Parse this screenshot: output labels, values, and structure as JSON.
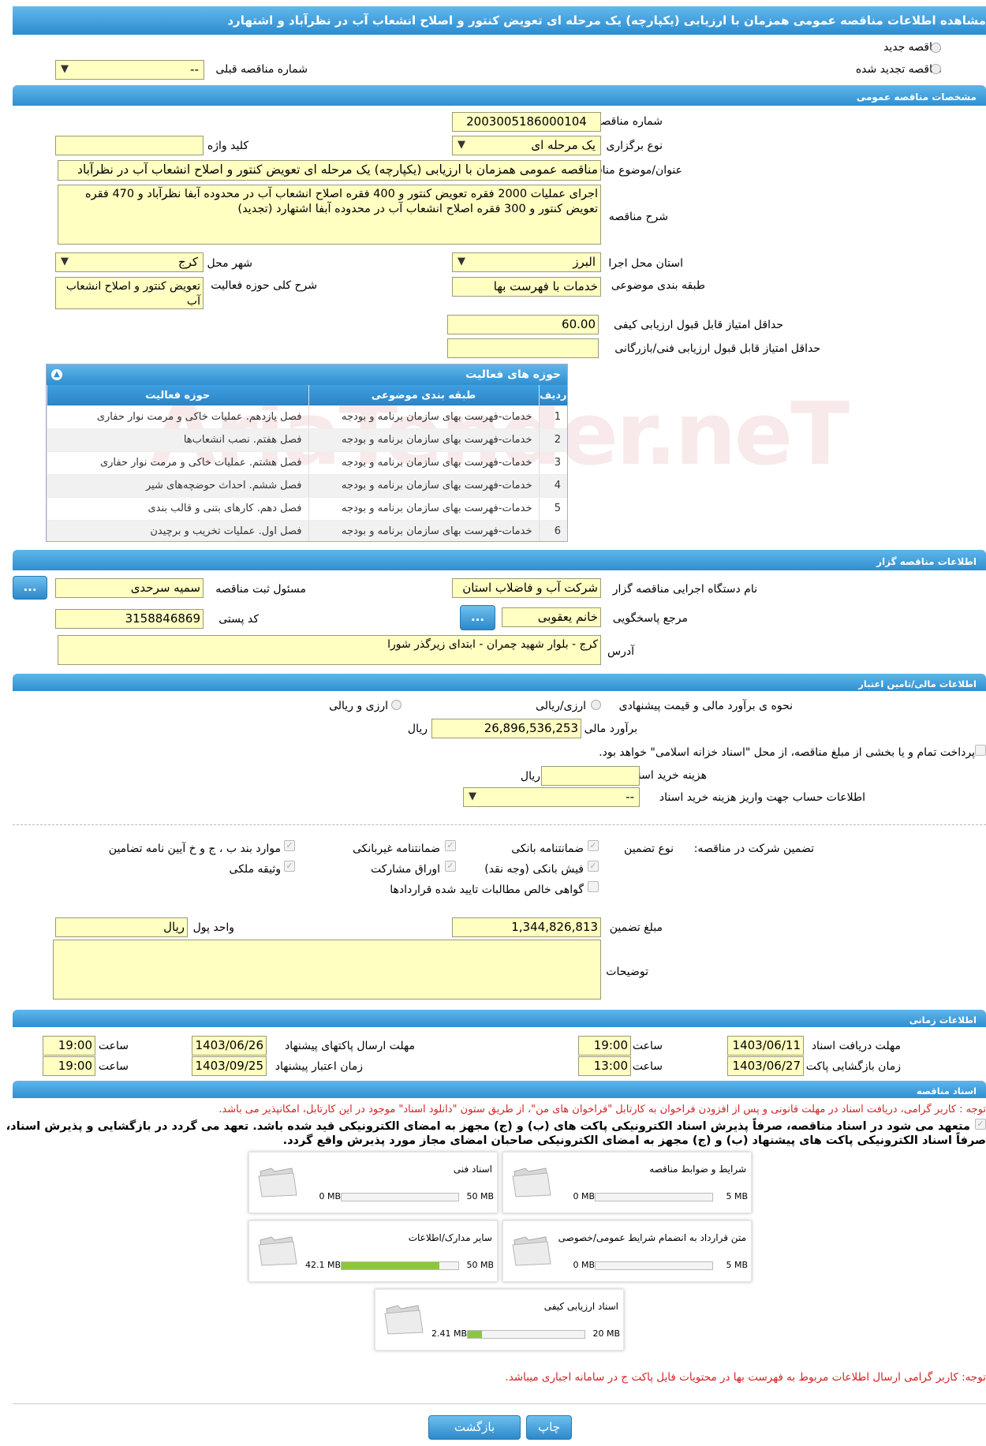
{
  "title": "مشاهده اطلاعات مناقصه عمومی همزمان با ارزیابی (یکپارچه) یک مرحله ای تعویض کنتور و اصلاح انشعاب آب در نظرآباد و اشتهارد",
  "top": {
    "new_tender": "مناقصه جدید",
    "renewed_tender": "مناقصه تجدید شده",
    "prev_tender_label": "شماره مناقصه قبلی",
    "prev_tender_value": "--"
  },
  "general": {
    "section": "مشخصات مناقصه عمومی",
    "tender_no_label": "شماره مناقصه",
    "tender_no": "2003005186000104",
    "type_label": "نوع برگزاری",
    "type_value": "یک مرحله ای",
    "keyword_label": "کلید واژه",
    "keyword": "",
    "subject_label": "عنوان/موضوع مناقصه",
    "subject": "مناقصه عمومی همزمان با ارزیابی (یکپارچه) یک مرحله ای تعویض کنتور و اصلاح انشعاب آب در نظرآباد",
    "desc_label": "شرح مناقصه",
    "desc": "اجرای عملیات 2000 فقره تعویض کنتور و 400 فقره اصلاح انشعاب آب در محدوده آبفا نظرآباد و 470 فقره تعویض کنتور و 300 فقره اصلاح انشعاب آب در محدوده آبفا اشتهارد (تجدید)",
    "province_label": "استان محل اجرا",
    "province": "البرز",
    "city_label": "شهر محل اجرا",
    "city": "کرج",
    "category_label": "طبقه بندی موضوعی",
    "category": "خدمات با فهرست بها",
    "activity_desc_label": "شرح کلی حوزه فعالیت",
    "activity_desc": "تعویض کنتور و اصلاح انشعاب آب",
    "min_quality_label": "حداقل امتیاز قابل قبول ارزیابی کیفی",
    "min_quality": "60.00",
    "min_tech_label": "حداقل امتیاز قابل قبول ارزیابی فنی/بازرگانی",
    "min_tech": ""
  },
  "activities": {
    "title": "حوزه های فعالیت",
    "headers": [
      "ردیف",
      "طبقه بندی موضوعی",
      "حوزه فعالیت"
    ],
    "rows": [
      {
        "no": "1",
        "cat": "خدمات-فهرست بهای سازمان برنامه و بودجه",
        "area": "فصل یازدهم. عملیات خاکی و مرمت نوار حفاری"
      },
      {
        "no": "2",
        "cat": "خدمات-فهرست بهای سازمان برنامه و بودجه",
        "area": "فصل هفتم. نصب انشعاب‌ها"
      },
      {
        "no": "3",
        "cat": "خدمات-فهرست بهای سازمان برنامه و بودجه",
        "area": "فصل هشتم. عملیات خاکی و مرمت نوار حفاری"
      },
      {
        "no": "4",
        "cat": "خدمات-فهرست بهای سازمان برنامه و بودجه",
        "area": "فصل ششم. احداث حوضچه‌های شیر"
      },
      {
        "no": "5",
        "cat": "خدمات-فهرست بهای سازمان برنامه و بودجه",
        "area": "فصل دهم. کارهای بتنی و قالب بندی"
      },
      {
        "no": "6",
        "cat": "خدمات-فهرست بهای سازمان برنامه و بودجه",
        "area": "فصل اول. عملیات تخریب و برچیدن"
      }
    ]
  },
  "organizer": {
    "section": "اطلاعات مناقصه گزار",
    "org_label": "نام دستگاه اجرایی مناقصه گزار",
    "org": "شرکت آب و فاضلاب استان",
    "registrar_label": "مسئول ثبت مناقصه",
    "registrar": "سمیه سرحدی",
    "ref_label": "مرجع پاسخگویی",
    "ref": "خانم یعقوبی",
    "postal_label": "کد پستی",
    "postal": "3158846869",
    "address_label": "آدرس",
    "address": "کرج - بلوار شهید چمران - ابتدای زیرگذر شورا",
    "more_btn": "..."
  },
  "financial": {
    "section": "اطلاعات مالی/تامین اعتبار",
    "method_label": "نحوه ی برآورد مالی و قیمت پیشنهادی",
    "opt1": "ارزی/ریالی",
    "opt2": "ارزی و ریالی",
    "estimate_label": "برآورد مالی",
    "estimate": "26,896,536,253",
    "rial": "ریال",
    "treasury_text": "پرداخت تمام و یا بخشی از مبلغ مناقصه، از محل \"اسناد خزانه اسلامی\" خواهد بود.",
    "doc_cost_label": "هزینه خرید اسناد",
    "doc_cost": "",
    "account_label": "اطلاعات حساب جهت واریز هزینه خرید اسناد",
    "account": "--"
  },
  "guarantee": {
    "label": "تضمین شرکت در مناقصه:",
    "type_label": "نوع تضمین",
    "opts": [
      "ضمانتنامه بانکی",
      "ضمانتنامه غیربانکی",
      "موارد بند ب ، ج و خ آیین نامه تضامین",
      "فیش بانکی (وجه نقد)",
      "اوراق مشارکت",
      "وثیقه ملکی",
      "گواهی خالص مطالبات تایید شده قراردادها"
    ],
    "amount_label": "مبلغ تضمین",
    "amount": "1,344,826,813",
    "currency_label": "واحد پول",
    "currency": "ریال",
    "notes_label": "توضیحات",
    "notes": ""
  },
  "timing": {
    "section": "اطلاعات زمانی",
    "doc_deadline_label": "مهلت دریافت اسناد",
    "doc_deadline": "1403/06/11",
    "doc_time": "19:00",
    "submit_deadline_label": "مهلت ارسال پاکتهای پیشنهاد",
    "submit_deadline": "1403/06/26",
    "submit_time": "19:00",
    "open_label": "زمان بازگشایی پاکت ها",
    "open_date": "1403/06/27",
    "open_time": "13:00",
    "validity_label": "زمان اعتبار پیشنهاد",
    "validity_date": "1403/09/25",
    "validity_time": "19:00",
    "hour_label": "ساعت"
  },
  "documents": {
    "section": "اسناد مناقصه",
    "notice1": "توجه : کاربر گرامی، دریافت اسناد در مهلت قانونی و پس از افزودن فراخوان به کارتابل \"فراخوان های من\"، از طریق ستون \"دانلود اسناد\" موجود در این کارتابل، امکانپذیر می باشد.",
    "commit1": "متعهد می شود در اسناد مناقصه، صرفاً پذیرش اسناد الکترونیکی پاکت های (ب) و (ج) مجهز به امضای الکترونیکی قید شده باشد. تعهد می گردد در بازگشایی و پذیرش اسناد،",
    "commit2": "صرفاً اسناد الکترونیکی پاکت های پیشنهاد (ب) و (ج) مجهز به امضای الکترونیکی صاحبان امضای مجاز مورد پذیرش واقع گردد.",
    "cards": [
      {
        "name": "شرایط و ضوابط مناقصه",
        "used": "0 MB",
        "max": "5 MB",
        "pct": 0
      },
      {
        "name": "اسناد فنی",
        "used": "0 MB",
        "max": "50 MB",
        "pct": 0
      },
      {
        "name": "متن قرارداد به انضمام شرایط عمومی/خصوصی",
        "used": "0 MB",
        "max": "5 MB",
        "pct": 0
      },
      {
        "name": "سایر مدارک/اطلاعات",
        "used": "42.1 MB",
        "max": "50 MB",
        "pct": 84
      },
      {
        "name": "اسناد ارزیابی کیفی",
        "used": "2.41 MB",
        "max": "20 MB",
        "pct": 12
      }
    ],
    "notice2": "توجه: کاربر گرامی ارسال اطلاعات مربوط به فهرست بها در محتویات فایل پاکت ج در سامانه اجباری میباشد."
  },
  "footer": {
    "back": "بازگشت",
    "print": "چاپ"
  },
  "watermark": "AriaTender.neT"
}
